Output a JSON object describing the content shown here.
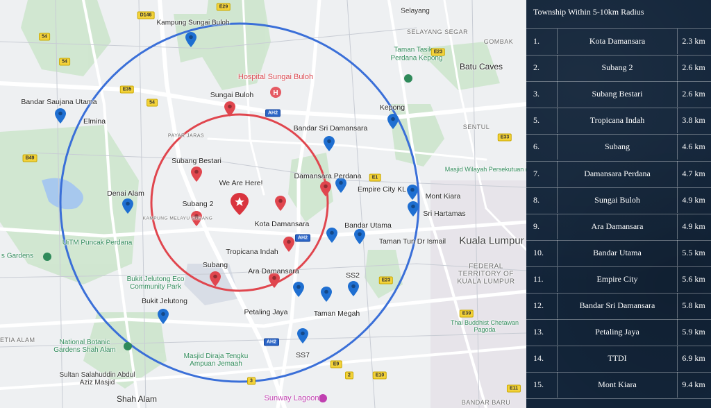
{
  "panel": {
    "title": "Township Within 5-10km Radius",
    "rows": [
      {
        "num": "1.",
        "name": "Kota Damansara",
        "dist": "2.3 km"
      },
      {
        "num": "2.",
        "name": "Subang 2",
        "dist": "2.6 km"
      },
      {
        "num": "3.",
        "name": "Subang Bestari",
        "dist": "2.6 km"
      },
      {
        "num": "5.",
        "name": "Tropicana Indah",
        "dist": "3.8 km"
      },
      {
        "num": "6.",
        "name": "Subang",
        "dist": "4.6 km"
      },
      {
        "num": "7.",
        "name": "Damansara Perdana",
        "dist": "4.7 km"
      },
      {
        "num": "8.",
        "name": "Sungai Buloh",
        "dist": "4.9 km"
      },
      {
        "num": "9.",
        "name": "Ara Damansara",
        "dist": "4.9 km"
      },
      {
        "num": "10.",
        "name": "Bandar Utama",
        "dist": "5.5 km"
      },
      {
        "num": "11.",
        "name": "Empire City",
        "dist": "5.6 km"
      },
      {
        "num": "12.",
        "name": "Bandar Sri Damansara",
        "dist": "5.8 km"
      },
      {
        "num": "13.",
        "name": "Petaling Jaya",
        "dist": "5.9 km"
      },
      {
        "num": "14.",
        "name": "TTDI",
        "dist": "6.9 km"
      },
      {
        "num": "15.",
        "name": "Mont Kiara",
        "dist": "9.4 km"
      }
    ]
  },
  "map": {
    "colors": {
      "inner_circle": "#e0464e",
      "outer_circle": "#3a6fd8",
      "red_pin": "#e0464e",
      "blue_pin": "#1f6fd1"
    },
    "center_label": "We Are Here!",
    "places": [
      {
        "id": "kampung-sungai-buloh",
        "text": "Kampung Sungai Buloh"
      },
      {
        "id": "selayang",
        "text": "Selayang"
      },
      {
        "id": "selayang-segar",
        "text": "SELAYANG SEGAR"
      },
      {
        "id": "taman-tasik",
        "text": "Taman Tasik"
      },
      {
        "id": "perdana-kepong",
        "text": "Perdana Kepong"
      },
      {
        "id": "gombak",
        "text": "GOMBAK"
      },
      {
        "id": "batu-caves",
        "text": "Batu Caves"
      },
      {
        "id": "hospital-sungai-buloh",
        "text": "Hospital Sungai Buloh"
      },
      {
        "id": "sungai-buloh",
        "text": "Sungai Buloh"
      },
      {
        "id": "bandar-saujana-utama",
        "text": "Bandar Saujana Utama"
      },
      {
        "id": "elmina",
        "text": "Elmina"
      },
      {
        "id": "kepong",
        "text": "Kepong"
      },
      {
        "id": "bandar-sri-damansara",
        "text": "Bandar Sri Damansara"
      },
      {
        "id": "sentul",
        "text": "SENTUL"
      },
      {
        "id": "payar-jaras",
        "text": "PAYAR JARAS"
      },
      {
        "id": "subang-bestari",
        "text": "Subang Bestari"
      },
      {
        "id": "damansara-perdana",
        "text": "Damansara Perdana"
      },
      {
        "id": "we-are-here",
        "text": "We Are Here!"
      },
      {
        "id": "empire-city",
        "text": "Empire City KL"
      },
      {
        "id": "masjid-wilayah",
        "text": "Masjid Wilayah Persekutuan (The"
      },
      {
        "id": "denai-alam",
        "text": "Denai Alam"
      },
      {
        "id": "subang-2",
        "text": "Subang 2"
      },
      {
        "id": "mont-kiara",
        "text": "Mont Kiara"
      },
      {
        "id": "sri-hartamas",
        "text": "Sri Hartamas"
      },
      {
        "id": "kampung-melayu-subang",
        "text": "KAMPUNG MELAYU SUBANG"
      },
      {
        "id": "kota-damansara",
        "text": "Kota Damansara"
      },
      {
        "id": "bandar-utama",
        "text": "Bandar Utama"
      },
      {
        "id": "uitm-puncak-perdana",
        "text": "UiTM Puncak Perdana"
      },
      {
        "id": "taman-tun-dr-ismail",
        "text": "Taman Tun Dr Ismail"
      },
      {
        "id": "kuala-lumpur",
        "text": "Kuala Lumpur"
      },
      {
        "id": "s-gardens",
        "text": "s Gardens"
      },
      {
        "id": "tropicana-indah",
        "text": "Tropicana Indah"
      },
      {
        "id": "federal-territory",
        "text": "FEDERAL TERRITORY OF KUALA LUMPUR"
      },
      {
        "id": "subang",
        "text": "Subang"
      },
      {
        "id": "ara-damansara",
        "text": "Ara Damansara"
      },
      {
        "id": "bukit-jelutong-park",
        "text": "Bukit Jelutong Eco Community Park"
      },
      {
        "id": "ss2",
        "text": "SS2"
      },
      {
        "id": "bukit-jelutong",
        "text": "Bukit Jelutong"
      },
      {
        "id": "petaling-jaya",
        "text": "Petaling Jaya"
      },
      {
        "id": "taman-megah",
        "text": "Taman Megah"
      },
      {
        "id": "thai-buddhist",
        "text": "Thai Buddhist Chetawan Pagoda"
      },
      {
        "id": "setia-alam",
        "text": "SETIA ALAM"
      },
      {
        "id": "national-botanic",
        "text": "National Botanic Gardens Shah Alam"
      },
      {
        "id": "masjid-tengku",
        "text": "Masjid Diraja Tengku Ampuan Jemaah"
      },
      {
        "id": "ss7",
        "text": "SS7"
      },
      {
        "id": "sultan-salahuddin",
        "text": "Sultan Salahuddin Abdul Aziz Masjid"
      },
      {
        "id": "shah-alam",
        "text": "Shah Alam"
      },
      {
        "id": "sunway-lagoon",
        "text": "Sunway Lagoon"
      },
      {
        "id": "bandar-baru",
        "text": "BANDAR BARU"
      }
    ],
    "highways": [
      "E29",
      "D146",
      "E23",
      "E35",
      "E1",
      "AH2",
      "E33",
      "E23",
      "E39",
      "E10",
      "E9",
      "E11",
      "F1",
      "54",
      "3",
      "2",
      "E5",
      "B49"
    ]
  }
}
